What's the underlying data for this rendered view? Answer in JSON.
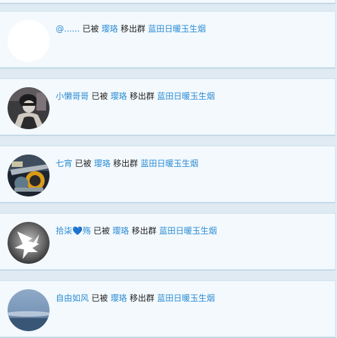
{
  "notifications": [
    {
      "user": "@......",
      "action_before": "已被",
      "actor": "璎珞",
      "action_after": "移出群",
      "group": "蓝田日暖玉生烟",
      "avatar": "blank-avatar"
    },
    {
      "user": "小懒哥哥",
      "action_before": "已被",
      "actor": "璎珞",
      "action_after": "移出群",
      "group": "蓝田日暖玉生烟",
      "avatar": "photo-avatar-dark"
    },
    {
      "user": "七宵",
      "action_before": "已被",
      "actor": "璎珞",
      "action_after": "移出群",
      "group": "蓝田日暖玉生烟",
      "avatar": "photo-avatar-machine"
    },
    {
      "user": "拾柒💙殇",
      "action_before": "已被",
      "actor": "璎珞",
      "action_after": "移出群",
      "group": "蓝田日暖玉生烟",
      "avatar": "wing-avatar"
    },
    {
      "user": "自由如风",
      "action_before": "已被",
      "actor": "璎珞",
      "action_after": "移出群",
      "group": "蓝田日暖玉生烟",
      "avatar": "sky-avatar"
    }
  ],
  "colors": {
    "link": "#2a8bd3",
    "card_bg": "#f3f9fd",
    "page_bg": "#dfeaf2"
  }
}
